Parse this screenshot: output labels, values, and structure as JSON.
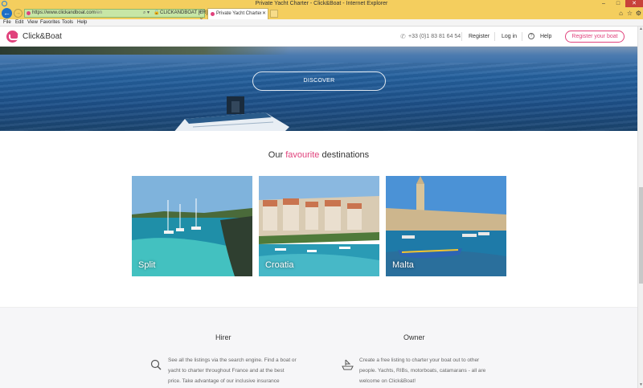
{
  "window": {
    "title": "Private Yacht Charter - Click&Boat - Internet Explorer",
    "minimize_glyph": "–",
    "maximize_glyph": "□",
    "close_glyph": "✕"
  },
  "browser": {
    "back_glyph": "←",
    "forward_glyph": "→",
    "url_host": "https://www.clickandboat.com",
    "url_path": "/en",
    "search_glyph": "⌕ ▾",
    "lock_glyph": "🔒",
    "site_identity": "CLICKANDBOAT [FR]",
    "refresh_glyph": "C ✕",
    "tab_title": "Private Yacht Charter - Clic...",
    "tab_close_glyph": "✕",
    "home_glyph": "⌂",
    "star_glyph": "☆",
    "gear_glyph": "⚙"
  },
  "menu": {
    "file": "File",
    "edit": "Edit",
    "view": "View",
    "favorites": "Favorites",
    "tools": "Tools",
    "help": "Help"
  },
  "header": {
    "logo": "Click&Boat",
    "phone_glyph": "✆",
    "phone": "+33 (0)1 83 81 64 54",
    "register": "Register",
    "login": "Log in",
    "help_glyph": "?",
    "help": "Help",
    "register_boat": "Register your boat",
    "accent_color": "#e0427c"
  },
  "hero": {
    "discover": "DISCOVER"
  },
  "destinations": {
    "title_prefix": "Our",
    "title_highlight": "favourite",
    "title_suffix": "destinations",
    "cards": [
      {
        "label": "Split"
      },
      {
        "label": "Croatia"
      },
      {
        "label": "Malta"
      }
    ]
  },
  "info": {
    "hirer_title": "Hirer",
    "owner_title": "Owner",
    "hirer_desc": "See all the listings via the search engine. Find a boat or yacht to charter throughout France and at the best price. Take advantage of our inclusive insurance",
    "owner_desc": "Create a free listing to charter your boat out to other people. Yachts, RIBs, motorboats, catamarans - all are welcome on Click&Boat!"
  },
  "scrollbar": {
    "up_glyph": "▲",
    "down_glyph": "▼"
  }
}
